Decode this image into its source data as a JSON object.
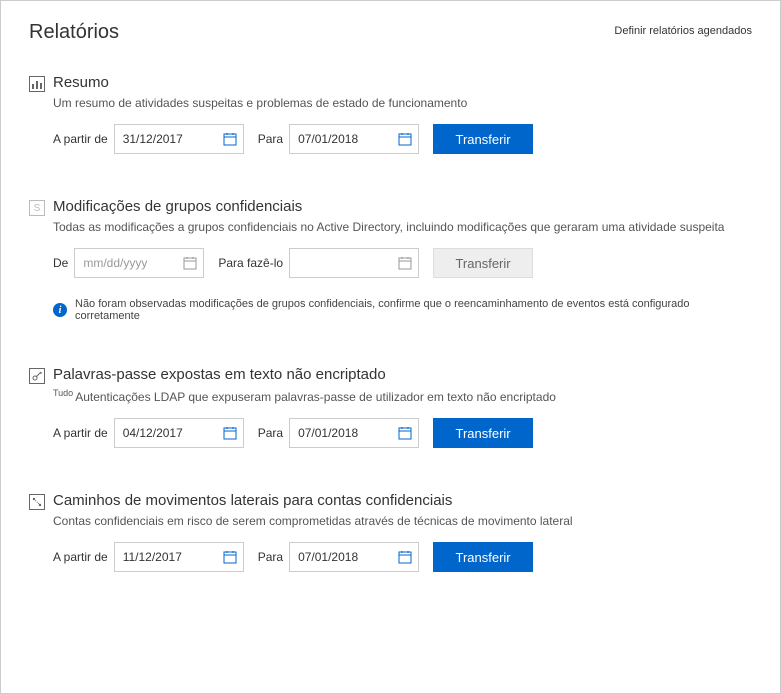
{
  "header": {
    "title": "Relatórios",
    "schedule_link": "Definir relatórios agendados"
  },
  "sections": {
    "summary": {
      "title": "Resumo",
      "desc": "Um resumo de atividades suspeitas e problemas de estado de funcionamento",
      "from_label": "A partir de",
      "from_value": "31/12/2017",
      "to_label": "Para",
      "to_value": "07/01/2018",
      "button": "Transferir"
    },
    "groups": {
      "title": "Modificações de grupos confidenciais",
      "desc": "Todas as modificações a grupos confidenciais no Active Directory, incluindo modificações que geraram uma atividade suspeita",
      "from_label": "De",
      "from_placeholder": "mm/dd/yyyy",
      "to_label": "Para fazê-lo",
      "button": "Transferir",
      "info": "Não foram observadas modificações de grupos confidenciais, confirme que o reencaminhamento de eventos está configurado corretamente"
    },
    "passwords": {
      "title": "Palavras-passe expostas em texto não encriptado",
      "sup": "Tudo",
      "desc": "Autenticações LDAP que expuseram palavras-passe de utilizador em texto não encriptado",
      "from_label": "A partir de",
      "from_value": "04/12/2017",
      "to_label": "Para",
      "to_value": "07/01/2018",
      "button": "Transferir"
    },
    "lateral": {
      "title": "Caminhos de movimentos laterais para contas confidenciais",
      "desc": "Contas confidenciais em risco de serem comprometidas através de técnicas de movimento lateral",
      "from_label": "A partir de",
      "from_value": "11/12/2017",
      "to_label": "Para",
      "to_value": "07/01/2018",
      "button": "Transferir"
    }
  }
}
